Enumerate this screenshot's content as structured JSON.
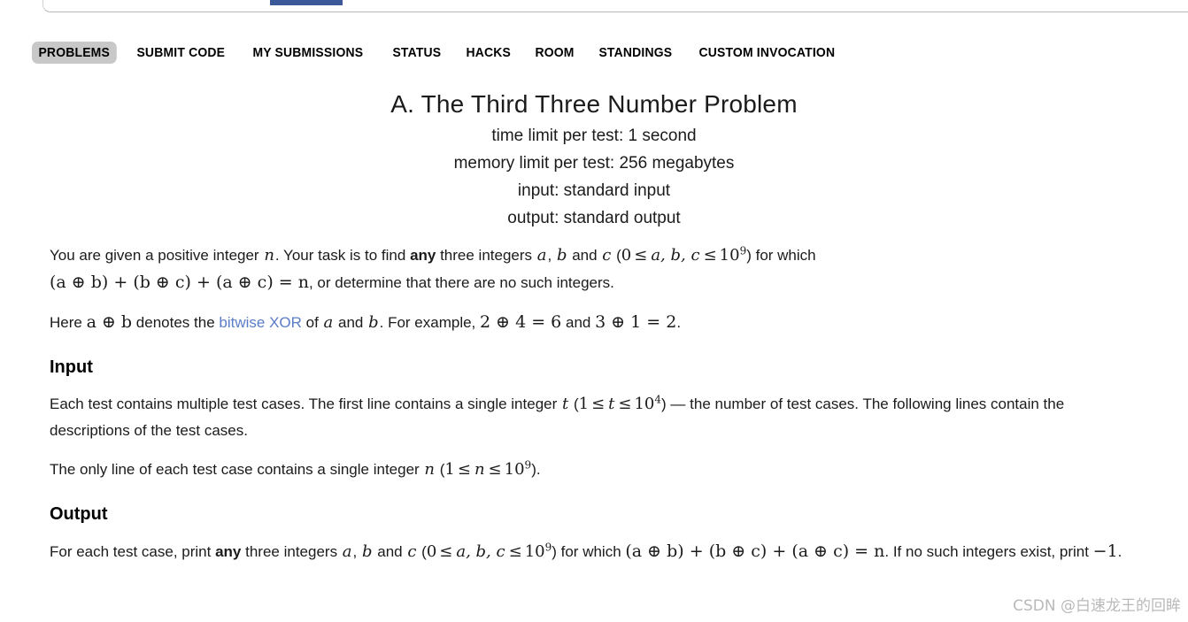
{
  "browser_chrome": {
    "active_tab_indicator_color": "#3b5998",
    "tabstrip_border_color": "#b9b9b9"
  },
  "secondary_nav": {
    "active_item_background": "#c8c8c8",
    "items": [
      {
        "label": "PROBLEMS",
        "active": true
      },
      {
        "label": "SUBMIT CODE",
        "active": false
      },
      {
        "label": "MY SUBMISSIONS",
        "active": false
      },
      {
        "label": "STATUS",
        "active": false
      },
      {
        "label": "HACKS",
        "active": false
      },
      {
        "label": "ROOM",
        "active": false
      },
      {
        "label": "STANDINGS",
        "active": false
      },
      {
        "label": "CUSTOM INVOCATION",
        "active": false
      }
    ]
  },
  "problem": {
    "title": "A. The Third Three Number Problem",
    "limits": {
      "time": "time limit per test: 1 second",
      "memory": "memory limit per test: 256 megabytes",
      "input": "input: standard input",
      "output": "output: standard output"
    },
    "statement": {
      "p1_a": "You are given a positive integer ",
      "p1_n": "n",
      "p1_b": ". Your task is to find ",
      "p1_any": "any",
      "p1_c": " three integers ",
      "p1_var_a": "a",
      "p1_comma": ", ",
      "p1_var_b": "b",
      "p1_and": " and ",
      "p1_var_c": "c",
      "p1_paren_open": " (",
      "p1_zero": "0",
      "p1_le1": "≤",
      "p1_abc": "a, b, c",
      "p1_le2": "≤",
      "p1_ten": "10",
      "p1_exp9": "9",
      "p1_paren_close": ")",
      "p1_d": " for which ",
      "p1_formula": "(a ⊕ b) + (b ⊕ c) + (a ⊕ c) = n",
      "p1_e": ", or determine that there are no such integers.",
      "p2_a": "Here ",
      "p2_ab": "a ⊕ b",
      "p2_b": " denotes the ",
      "p2_link": "bitwise XOR",
      "p2_c": " of ",
      "p2_var_a": "a",
      "p2_and": " and ",
      "p2_var_b": "b",
      "p2_d": ". For example, ",
      "p2_ex1": "2 ⊕ 4 = 6",
      "p2_e": " and ",
      "p2_ex2": "3 ⊕ 1 = 2",
      "p2_f": "."
    },
    "input_section": {
      "heading": "Input",
      "p1_a": "Each test contains multiple test cases. The first line contains a single integer ",
      "p1_t": "t",
      "p1_paren_open": " (",
      "p1_one": "1",
      "p1_le1": "≤",
      "p1_t2": "t",
      "p1_le2": "≤",
      "p1_ten": "10",
      "p1_exp4": "4",
      "p1_paren_close": ")",
      "p1_b": " — the number of test cases. The following lines contain the descriptions of the test cases.",
      "p2_a": "The only line of each test case contains a single integer ",
      "p2_n": "n",
      "p2_paren_open": " (",
      "p2_one": "1",
      "p2_le1": "≤",
      "p2_n2": "n",
      "p2_le2": "≤",
      "p2_ten": "10",
      "p2_exp9": "9",
      "p2_paren_close": ")",
      "p2_b": "."
    },
    "output_section": {
      "heading": "Output",
      "p1_a": "For each test case, print ",
      "p1_any": "any",
      "p1_b": " three integers ",
      "p1_var_a": "a",
      "p1_comma": ", ",
      "p1_var_b": "b",
      "p1_and": " and ",
      "p1_var_c": "c",
      "p1_paren_open": " (",
      "p1_zero": "0",
      "p1_le1": "≤",
      "p1_abc": "a, b, c",
      "p1_le2": "≤",
      "p1_ten": "10",
      "p1_exp9": "9",
      "p1_paren_close": ")",
      "p1_c": " for which ",
      "p1_formula": "(a ⊕ b) + (b ⊕ c) + (a ⊕ c) = n",
      "p1_d": ". If no such integers exist, print ",
      "p1_minus_one": "−1",
      "p1_e": "."
    }
  },
  "watermark": {
    "text": "CSDN @白速龙王的回眸"
  }
}
